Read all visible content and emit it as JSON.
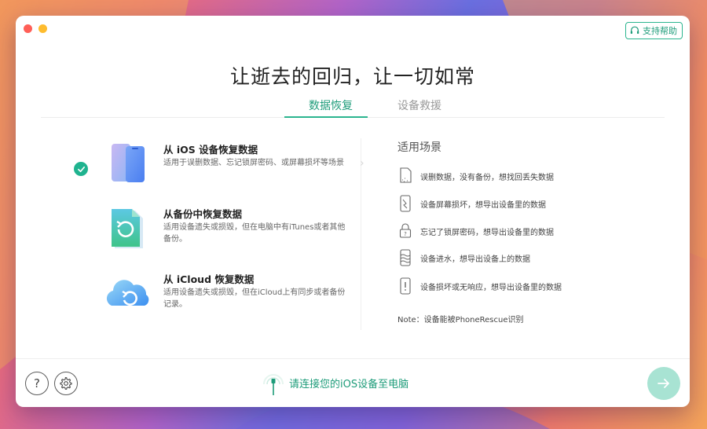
{
  "window": {
    "support_label": "支持帮助",
    "main_title": "让逝去的回归，让一切如常"
  },
  "tabs": [
    {
      "label": "数据恢复",
      "active": true
    },
    {
      "label": "设备救援",
      "active": false
    }
  ],
  "options": [
    {
      "title": "从 iOS 设备恢复数据",
      "desc": "适用于误删数据、忘记锁屏密码、或屏幕损坏等场景",
      "selected": true,
      "icon": "phone-icon"
    },
    {
      "title": "从备份中恢复数据",
      "desc": "适用设备遗失或损毁，但在电脑中有iTunes或者其他备份。",
      "selected": false,
      "icon": "backup-file-icon"
    },
    {
      "title": "从 iCloud 恢复数据",
      "desc": "适用设备遗失或损毁，但在iCloud上有同步或者备份记录。",
      "selected": false,
      "icon": "icloud-icon"
    }
  ],
  "scenarios": {
    "title": "适用场景",
    "items": [
      {
        "text": "误删数据，没有备份，想找回丢失数据",
        "icon": "deleted-data-icon"
      },
      {
        "text": "设备屏幕损坏，想导出设备里的数据",
        "icon": "broken-screen-icon"
      },
      {
        "text": "忘记了锁屏密码，想导出设备里的数据",
        "icon": "lock-icon"
      },
      {
        "text": "设备进水，想导出设备上的数据",
        "icon": "water-damage-icon"
      },
      {
        "text": "设备损坏或无响应，想导出设备里的数据",
        "icon": "unresponsive-icon"
      }
    ],
    "note": "Note：设备能被PhoneRescue识别"
  },
  "footer": {
    "connect_text": "请连接您的iOS设备至电脑"
  },
  "colors": {
    "accent": "#1e9c7a",
    "accent_light": "#a8e3d3",
    "check": "#1fb38f"
  }
}
